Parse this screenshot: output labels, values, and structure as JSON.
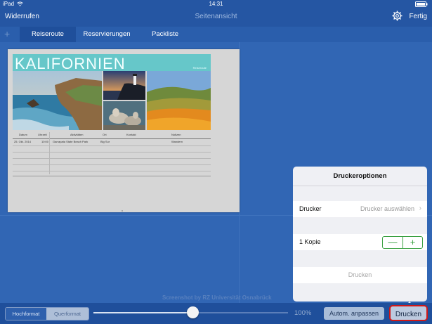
{
  "status_bar": {
    "carrier": "iPad",
    "time": "14:31"
  },
  "nav": {
    "back_label": "Widerrufen",
    "title": "Seitenansicht",
    "done_label": "Fertig"
  },
  "tabs": [
    {
      "label": "Reiseroute",
      "active": true
    },
    {
      "label": "Reservierungen",
      "active": false
    },
    {
      "label": "Packliste",
      "active": false
    }
  ],
  "page": {
    "title": "KALIFORNIEN",
    "subtitle": "Reiseroute",
    "table": {
      "headers": [
        "Datum",
        "Uhrzeit",
        "Aktivitäten",
        "Ort",
        "Kontakt",
        "Notizen"
      ],
      "rows": [
        [
          "25. Okt. 2014",
          "10:00",
          "Garrapata State Beach Park",
          "Big Sur",
          "",
          "Wandern"
        ]
      ]
    }
  },
  "popover": {
    "title": "Druckeroptionen",
    "printer_label": "Drucker",
    "printer_value": "Drucker auswählen",
    "copies_label": "1 Kopie",
    "stepper_minus": "—",
    "stepper_plus": "+",
    "print_label": "Drucken"
  },
  "bottom": {
    "orientation_options": [
      "Hochformat",
      "Querformat"
    ],
    "selected_orientation": "Hochformat",
    "zoom_fraction": 0.51,
    "zoom_label": "100%",
    "fit_label": "Autom. anpassen",
    "print_label": "Drucken"
  },
  "watermark": "Screenshot by RZ Universität Osnabrück",
  "colors": {
    "nav_bg": "#2556a3",
    "canvas_bg": "#3166b4",
    "accent_teal": "#66c7c9",
    "stepper_green": "#3aa142",
    "highlight_red": "#d01818"
  },
  "icons": {
    "wifi": "wifi-icon",
    "battery": "battery-icon",
    "gear": "gear-icon",
    "add": "plus-icon",
    "chevron": "chevron-right-icon"
  }
}
